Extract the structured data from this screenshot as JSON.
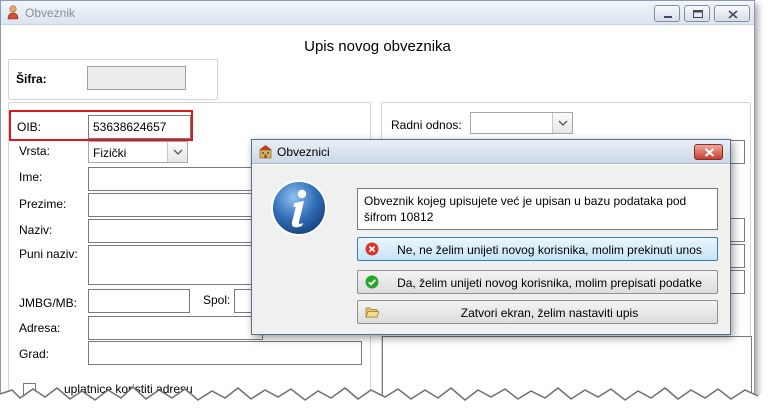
{
  "window": {
    "title": "Obveznik"
  },
  "main": {
    "heading": "Upis novog obveznika",
    "sifra_label": "Šifra:",
    "sifra_value": "",
    "fields": {
      "oib_label": "OIB:",
      "oib_value": "53638624657",
      "vrsta_label": "Vrsta:",
      "vrsta_value": "Fizički",
      "ime_label": "Ime:",
      "prezime_label": "Prezime:",
      "naziv_label": "Naziv:",
      "puni_naziv_label": "Puni naziv:",
      "jmbg_label": "JMBG/MB:",
      "spol_label": "Spol:",
      "adresa_label": "Adresa:",
      "grad_label": "Grad:"
    },
    "radni_odnos_label": "Radni odnos:",
    "bottom_checkbox_label": "uplatnice koristiti adresu"
  },
  "dialog": {
    "title": "Obveznici",
    "message": "Obveznik kojeg upisujete već je upisan u bazu podataka pod šifrom 10812",
    "buttons": {
      "cancel": "Ne, ne želim unijeti novog korisnika, molim prekinuti unos",
      "confirm": "Da, želim unijeti novog korisnika, molim prepisati podatke",
      "close": "Zatvori ekran, želim nastaviti upis"
    }
  },
  "colors": {
    "highlight": "#e0161e",
    "info_icon": "#2f6db5",
    "close_red": "#c2422f",
    "ok_green": "#2aa52a"
  }
}
